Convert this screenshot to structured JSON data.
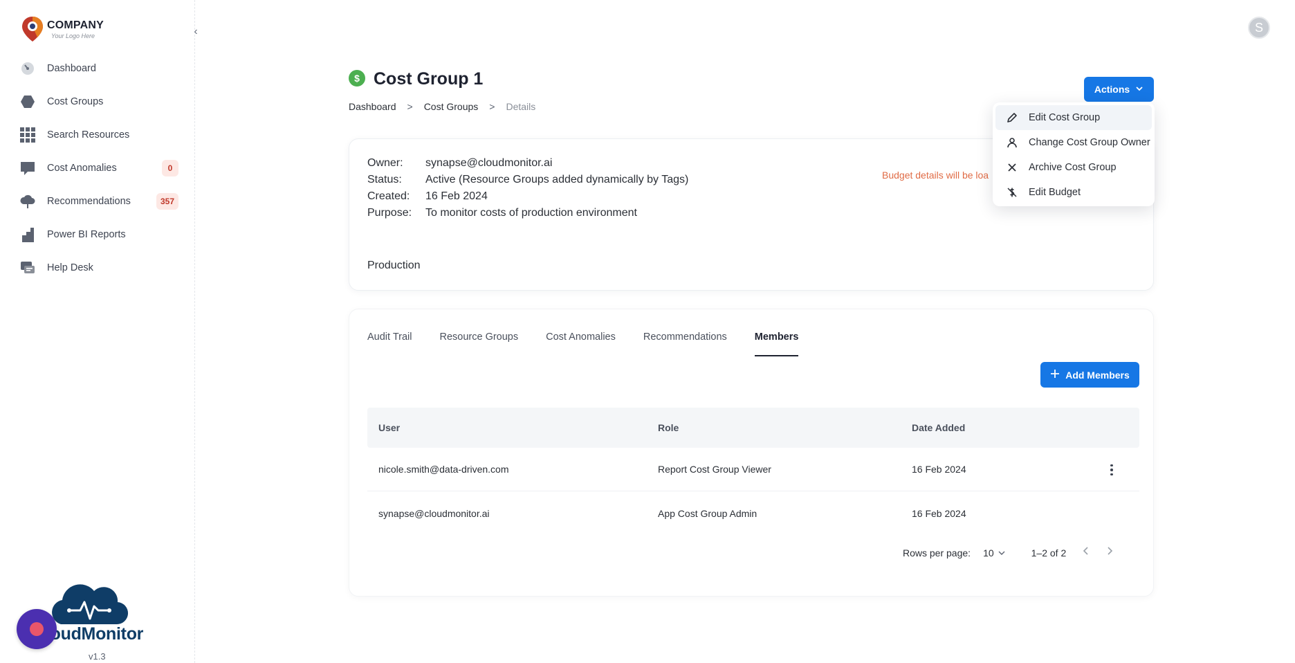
{
  "brand": {
    "name": "COMPANY",
    "tagline": "Your Logo Here"
  },
  "sidebar": {
    "items": [
      {
        "label": "Dashboard",
        "icon": "gauge-icon",
        "badge": null
      },
      {
        "label": "Cost Groups",
        "icon": "hexagon-icon",
        "badge": null
      },
      {
        "label": "Search Resources",
        "icon": "grid-icon",
        "badge": null
      },
      {
        "label": "Cost Anomalies",
        "icon": "chat-icon",
        "badge": "0"
      },
      {
        "label": "Recommendations",
        "icon": "cloud-icon",
        "badge": "357"
      },
      {
        "label": "Power BI Reports",
        "icon": "chart-icon",
        "badge": null
      },
      {
        "label": "Help Desk",
        "icon": "helpdesk-icon",
        "badge": null
      }
    ],
    "product_name": "CloudMonitor",
    "product_name_visible": "loudMonitor",
    "version": "v1.3"
  },
  "user": {
    "avatar_initial": "S"
  },
  "header": {
    "title": "Cost Group 1",
    "title_icon": "dollar-icon",
    "breadcrumb": [
      "Dashboard",
      "Cost Groups",
      "Details"
    ],
    "breadcrumb_sep": ">",
    "actions_label": "Actions"
  },
  "details": {
    "owner_key": "Owner:",
    "owner": "synapse@cloudmonitor.ai",
    "status_key": "Status:",
    "status": "Active (Resource Groups added dynamically by Tags)",
    "created_key": "Created:",
    "created": "16 Feb 2024",
    "purpose_key": "Purpose:",
    "purpose": "To monitor costs of production environment",
    "budget_message": "Budget details will be loa",
    "tag": "Production"
  },
  "actions_menu": [
    {
      "label": "Edit Cost Group",
      "icon": "pencil-icon"
    },
    {
      "label": "Change Cost Group Owner",
      "icon": "person-icon"
    },
    {
      "label": "Archive Cost Group",
      "icon": "close-icon"
    },
    {
      "label": "Edit Budget",
      "icon": "no-money-icon"
    }
  ],
  "tabs": [
    "Audit Trail",
    "Resource Groups",
    "Cost Anomalies",
    "Recommendations",
    "Members"
  ],
  "active_tab": "Members",
  "members": {
    "add_label": "Add Members",
    "columns": [
      "User",
      "Role",
      "Date Added"
    ],
    "rows": [
      {
        "user": "nicole.smith@data-driven.com",
        "role": "Report Cost Group Viewer",
        "date": "16 Feb 2024"
      },
      {
        "user": "synapse@cloudmonitor.ai",
        "role": "App Cost Group Admin",
        "date": "16 Feb 2024"
      }
    ],
    "rows_per_page_label": "Rows per page:",
    "rows_per_page": "10",
    "range": "1–2 of 2"
  },
  "colors": {
    "primary": "#1677e5",
    "badge_bg": "#fde8e4",
    "badge_text": "#c0392b",
    "budget_text": "#e06b45"
  }
}
